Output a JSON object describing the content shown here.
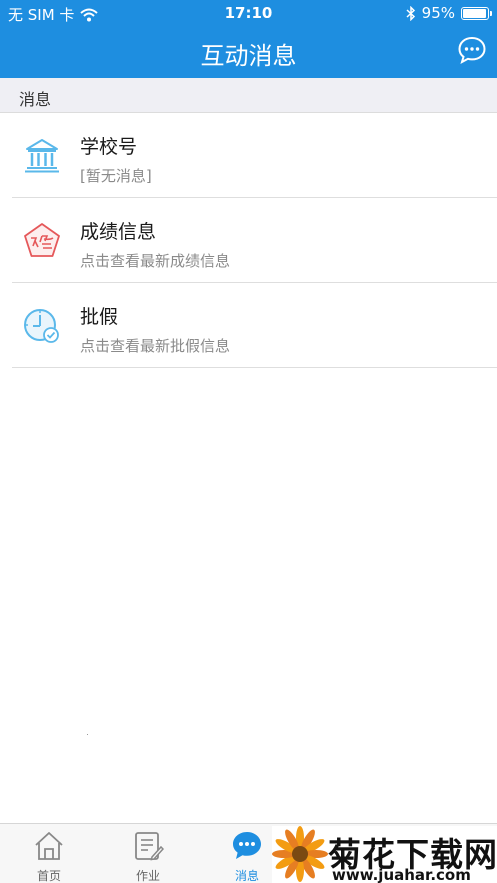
{
  "status_bar": {
    "carrier": "无 SIM 卡",
    "time": "17:10",
    "battery_percent": "95%",
    "battery_level": 0.95
  },
  "nav": {
    "title": "互动消息"
  },
  "section": {
    "label": "消息"
  },
  "messages": [
    {
      "title": "学校号",
      "subtitle": "[暂无消息]",
      "icon": "school-icon",
      "icon_color": "#5ab8ea"
    },
    {
      "title": "成绩信息",
      "subtitle": "点击查看最新成绩信息",
      "icon": "grade-icon",
      "icon_color": "#e5585a"
    },
    {
      "title": "批假",
      "subtitle": "点击查看最新批假信息",
      "icon": "clock-check-icon",
      "icon_color": "#5ab8ea"
    }
  ],
  "tabs": [
    {
      "label": "首页",
      "icon": "home-icon",
      "active": false
    },
    {
      "label": "作业",
      "icon": "homework-icon",
      "active": false
    },
    {
      "label": "消息",
      "icon": "message-bubble-icon",
      "active": true
    }
  ],
  "watermark": {
    "title": "菊花下载网",
    "url": "www.juahar.com"
  },
  "colors": {
    "accent": "#1e8ee0",
    "section_bg": "#efeff4"
  }
}
